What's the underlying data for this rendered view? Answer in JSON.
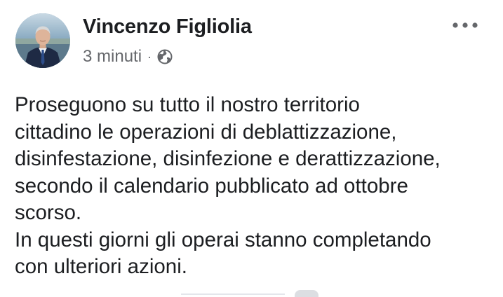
{
  "post": {
    "author_name": "Vincenzo Figliolia",
    "timestamp": "3 minuti",
    "separator": "·",
    "audience_icon": "globe-icon",
    "more_options_icon": "ellipsis-icon",
    "text": "Proseguono su tutto il nostro territorio\ncittadino le operazioni di deblattizzazione,\ndisinfestazione, disinfezione e derattizzazione,\nsecondo il calendario pubblicato ad ottobre\nscorso.\nIn questi giorni gli operai stanno completando\ncon ulteriori azioni."
  },
  "colors": {
    "text_primary": "#1c1e21",
    "text_secondary": "#65676b",
    "background": "#ffffff"
  }
}
